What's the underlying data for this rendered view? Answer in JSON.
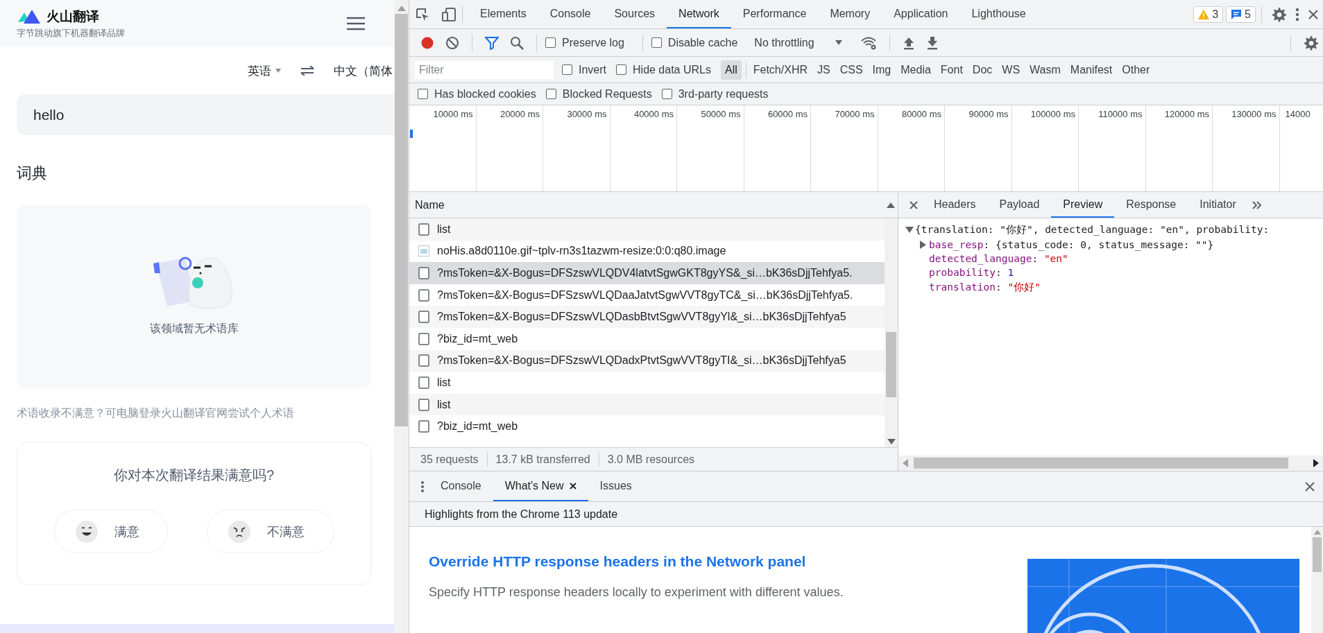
{
  "page": {
    "logo_name": "火山翻译",
    "tagline": "字节跳动旗下机器翻译品牌",
    "source_language": "英语",
    "target_language": "中文（简体",
    "input_value": "hello",
    "dictionary_heading": "词典",
    "empty_text": "该领域暂无术语库",
    "hint": "术语收录不满意？可电脑登录火山翻译官网尝试个人术语",
    "feedback": {
      "question": "你对本次翻译结果满意吗?",
      "options": [
        {
          "label": "满意",
          "kind": "happy"
        },
        {
          "label": "不满意",
          "kind": "angry"
        }
      ]
    }
  },
  "devtools": {
    "tabs": [
      {
        "label": "Elements",
        "selected": false
      },
      {
        "label": "Console",
        "selected": false
      },
      {
        "label": "Sources",
        "selected": false
      },
      {
        "label": "Network",
        "selected": true
      },
      {
        "label": "Performance",
        "selected": false
      },
      {
        "label": "Memory",
        "selected": false
      },
      {
        "label": "Application",
        "selected": false
      },
      {
        "label": "Lighthouse",
        "selected": false
      }
    ],
    "warning_count": "3",
    "message_count": "5",
    "toolbar": {
      "options": [
        {
          "label": "Preserve log",
          "checked": false
        },
        {
          "label": "Disable cache",
          "checked": false
        }
      ],
      "throttling": "No throttling"
    },
    "filter": {
      "placeholder": "Filter",
      "options": [
        {
          "label": "Invert",
          "checked": false
        },
        {
          "label": "Hide data URLs",
          "checked": false
        }
      ],
      "types": [
        {
          "label": "All",
          "selected": true
        },
        {
          "label": "Fetch/XHR",
          "selected": false
        },
        {
          "label": "JS",
          "selected": false
        },
        {
          "label": "CSS",
          "selected": false
        },
        {
          "label": "Img",
          "selected": false
        },
        {
          "label": "Media",
          "selected": false
        },
        {
          "label": "Font",
          "selected": false
        },
        {
          "label": "Doc",
          "selected": false
        },
        {
          "label": "WS",
          "selected": false
        },
        {
          "label": "Wasm",
          "selected": false
        },
        {
          "label": "Manifest",
          "selected": false
        },
        {
          "label": "Other",
          "selected": false
        }
      ]
    },
    "blocked_options": [
      {
        "label": "Has blocked cookies",
        "checked": false
      },
      {
        "label": "Blocked Requests",
        "checked": false
      },
      {
        "label": "3rd-party requests",
        "checked": false
      }
    ],
    "timeline_ticks": [
      "10000 ms",
      "20000 ms",
      "30000 ms",
      "40000 ms",
      "50000 ms",
      "60000 ms",
      "70000 ms",
      "80000 ms",
      "90000 ms",
      "100000 ms",
      "110000 ms",
      "120000 ms",
      "130000 ms",
      "14000"
    ],
    "requests": {
      "column": "Name",
      "rows": [
        {
          "name": "list",
          "kind": "document",
          "selected": false
        },
        {
          "name": "noHis.a8d0110e.gif~tplv-rn3s1tazwm-resize:0:0:q80.image",
          "kind": "image",
          "selected": false
        },
        {
          "name": "?msToken=&X-Bogus=DFSzswVLQDV4latvtSgwGKT8gyYS&_si…bK36sDjjTehfya5.",
          "kind": "document",
          "selected": true
        },
        {
          "name": "?msToken=&X-Bogus=DFSzswVLQDaaJatvtSgwVVT8gyTC&_si…bK36sDjjTehfya5.",
          "kind": "document",
          "selected": false
        },
        {
          "name": "?msToken=&X-Bogus=DFSzswVLQDasbBtvtSgwVVT8gyYl&_si…bK36sDjjTehfya5",
          "kind": "document",
          "selected": false
        },
        {
          "name": "?biz_id=mt_web",
          "kind": "document",
          "selected": false
        },
        {
          "name": "?msToken=&X-Bogus=DFSzswVLQDadxPtvtSgwVVT8gyTI&_si…bK36sDjjTehfya5",
          "kind": "document",
          "selected": false
        },
        {
          "name": "list",
          "kind": "document",
          "selected": false
        },
        {
          "name": "list",
          "kind": "document",
          "selected": false
        },
        {
          "name": "?biz_id=mt_web",
          "kind": "document",
          "selected": false
        }
      ],
      "summary": [
        "35 requests",
        "13.7 kB transferred",
        "3.0 MB resources"
      ]
    },
    "details": {
      "tabs": [
        {
          "label": "Headers",
          "selected": false
        },
        {
          "label": "Payload",
          "selected": false
        },
        {
          "label": "Preview",
          "selected": true
        },
        {
          "label": "Response",
          "selected": false
        },
        {
          "label": "Initiator",
          "selected": false
        }
      ],
      "preview": {
        "expanded": true,
        "parts": [
          {
            "kind": "plain",
            "text": "{translation: \"你好\", detected_language: \"en\", probability:"
          }
        ],
        "children": [
          {
            "expanded": false,
            "parts": [
              {
                "kind": "key",
                "text": "base_resp"
              },
              {
                "kind": "plain",
                "text": ": {status_code: 0, status_message: \"\"}"
              }
            ]
          },
          {
            "parts": [
              {
                "kind": "key",
                "text": "detected_language"
              },
              {
                "kind": "plain",
                "text": ": "
              },
              {
                "kind": "string",
                "text": "\"en\""
              }
            ]
          },
          {
            "parts": [
              {
                "kind": "key",
                "text": "probability"
              },
              {
                "kind": "plain",
                "text": ": "
              },
              {
                "kind": "number",
                "text": "1"
              }
            ]
          },
          {
            "parts": [
              {
                "kind": "key",
                "text": "translation"
              },
              {
                "kind": "plain",
                "text": ": "
              },
              {
                "kind": "string",
                "text": "\"你好\""
              }
            ]
          }
        ]
      }
    },
    "drawer": {
      "tabs": [
        {
          "label": "Console",
          "selected": false,
          "closable": false
        },
        {
          "label": "What's New",
          "selected": true,
          "closable": true
        },
        {
          "label": "Issues",
          "selected": false,
          "closable": false
        }
      ],
      "highlights": "Highlights from the Chrome 113 update",
      "headline": "Override HTTP response headers in the Network panel",
      "description": "Specify HTTP response headers locally to experiment with different values."
    }
  }
}
